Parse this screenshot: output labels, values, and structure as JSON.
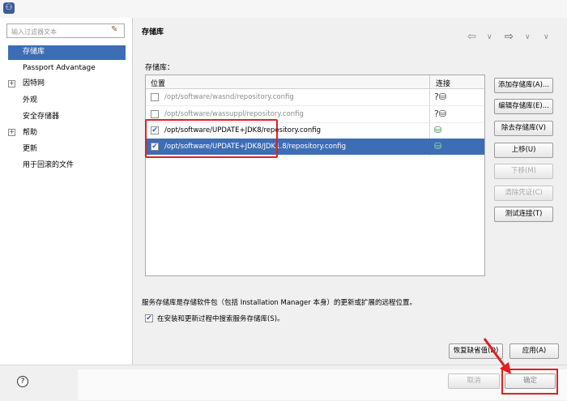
{
  "filter": {
    "placeholder": "输入过滤器文本"
  },
  "nav": [
    {
      "label": "存储库",
      "selected": true,
      "expandable": false
    },
    {
      "label": "Passport Advantage",
      "selected": false,
      "expandable": false
    },
    {
      "label": "因特网",
      "selected": false,
      "expandable": true
    },
    {
      "label": "外观",
      "selected": false,
      "expandable": false
    },
    {
      "label": "安全存储器",
      "selected": false,
      "expandable": false
    },
    {
      "label": "帮助",
      "selected": false,
      "expandable": true
    },
    {
      "label": "更新",
      "selected": false,
      "expandable": false
    },
    {
      "label": "用于回滚的文件",
      "selected": false,
      "expandable": false
    }
  ],
  "page": {
    "title": "存储库",
    "section_label": "存储库：",
    "columns": {
      "location": "位置",
      "connection": "连接"
    },
    "rows": [
      {
        "checked": false,
        "path": "/opt/software/wasnd/repository.config",
        "enabled": false,
        "selected": false,
        "conn_icon": "unknown-connection-icon"
      },
      {
        "checked": false,
        "path": "/opt/software/wassuppl/repository.config",
        "enabled": false,
        "selected": false,
        "conn_icon": "unknown-connection-icon"
      },
      {
        "checked": true,
        "path": "/opt/software/UPDATE+JDK8/repository.config",
        "enabled": true,
        "selected": false,
        "conn_icon": "connected-icon"
      },
      {
        "checked": true,
        "path": "/opt/software/UPDATE+JDK8/JDK1.8/repository.config",
        "enabled": true,
        "selected": true,
        "conn_icon": "connected-icon"
      }
    ],
    "buttons": {
      "add": "添加存储库(A)...",
      "edit": "编辑存储库(E)...",
      "remove": "除去存储库(V)",
      "up": "上移(U)",
      "down": "下移(M)",
      "clear": "清除凭证(C)",
      "test": "测试连接(T)"
    },
    "description": "服务存储库是存储软件包（包括 Installation Manager 本身）的更新或扩展的远程位置。",
    "search_checkbox": {
      "label": "在安装和更新过程中搜索服务存储库(S)。",
      "checked": true
    },
    "restore_default": "恢复缺省值(D)",
    "apply": "应用(A)"
  },
  "dialog": {
    "cancel": "取消",
    "ok": "确定"
  },
  "colors": {
    "selection": "#3d6db5",
    "annotation_red": "#e02020"
  }
}
